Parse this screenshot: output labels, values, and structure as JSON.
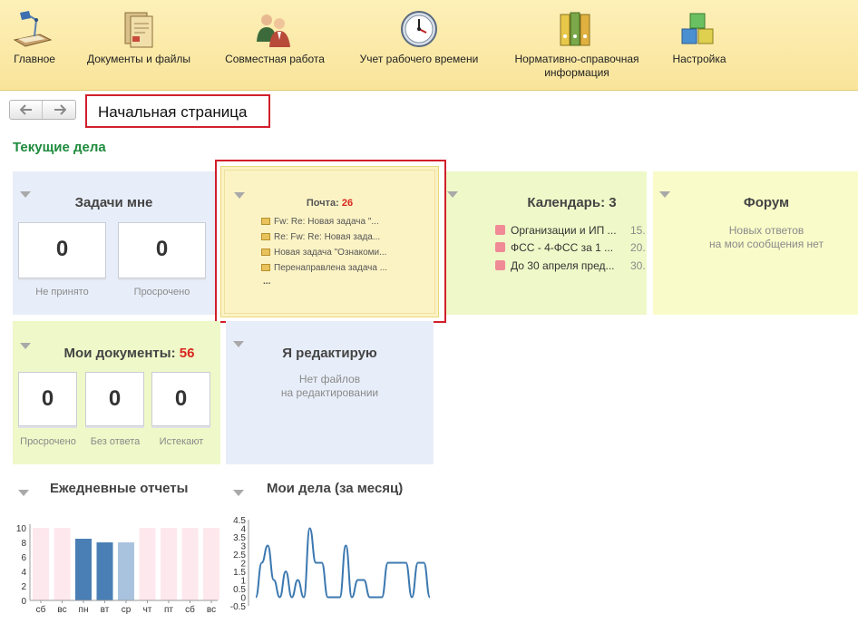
{
  "sections": [
    {
      "label": "Главное",
      "icon": "desk-lamp-icon"
    },
    {
      "label": "Документы и файлы",
      "icon": "documents-icon"
    },
    {
      "label": "Совместная работа",
      "icon": "people-icon"
    },
    {
      "label": "Учет рабочего времени",
      "icon": "clock-icon"
    },
    {
      "label": "Нормативно-справочная\nинформация",
      "icon": "binders-icon"
    },
    {
      "label": "Настройка",
      "icon": "cubes-icon"
    }
  ],
  "page": {
    "title": "Начальная страница",
    "section_heading": "Текущие дела"
  },
  "tasks": {
    "title": "Задачи мне",
    "not_accepted": "0",
    "overdue": "0",
    "not_accepted_label": "Не принято",
    "overdue_label": "Просрочено"
  },
  "mail": {
    "title": "Почта:",
    "count": "26",
    "items": [
      "Fw: Re: Новая задача \"...",
      "Re: Fw: Re: Новая зада...",
      "Новая задача \"Ознакоми...",
      "Перенаправлена задача ..."
    ],
    "more": "..."
  },
  "calendar": {
    "title": "Календарь: 3",
    "items": [
      {
        "text": "Организации и ИП ...",
        "date": "15."
      },
      {
        "text": "ФСС - 4-ФСС за 1 ...",
        "date": "20."
      },
      {
        "text": "До 30 апреля пред...",
        "date": "30."
      }
    ]
  },
  "forum": {
    "title": "Форум",
    "message": "Новых ответов\nна мои сообщения нет"
  },
  "my_documents": {
    "title": "Мои документы:",
    "count": "56",
    "overdue": "0",
    "no_answer": "0",
    "expiring": "0",
    "overdue_label": "Просрочено",
    "no_answer_label": "Без ответа",
    "expiring_label": "Истекают"
  },
  "editing": {
    "title": "Я редактирую",
    "message": "Нет файлов\nна редактировании"
  },
  "colors": {
    "topbar": "#f9e49a",
    "tile_blue": "#e8eef9",
    "tile_yellow": "#fbf3c4",
    "tile_green": "#eff8c8",
    "tile_lightyellow": "#f9fbc9",
    "accent_red": "#d11f2b",
    "heading_green": "#1e8b3c"
  },
  "chart_data": [
    {
      "type": "bar",
      "title": "Ежедневные отчеты",
      "categories": [
        "сб",
        "вс",
        "пн",
        "вт",
        "ср",
        "чт",
        "пт",
        "сб",
        "вс"
      ],
      "y_ticks": [
        "0",
        "2",
        "4",
        "6",
        "8",
        "10"
      ],
      "ylim": [
        0,
        10
      ],
      "series": [
        {
          "values": [
            0,
            0,
            8.5,
            8,
            8,
            0,
            0,
            0,
            0
          ],
          "colors": [
            "#fde8ee",
            "#fde8ee",
            "#4a7fb5",
            "#4a7fb5",
            "#a9c3df",
            "#fde8ee",
            "#fde8ee",
            "#fde8ee",
            "#fde8ee"
          ]
        }
      ],
      "background_values": [
        10,
        10,
        0,
        0,
        0,
        10,
        10,
        10,
        10
      ]
    },
    {
      "type": "line",
      "title": "Мои дела (за месяц)",
      "y_ticks": [
        "-0.5",
        "0",
        "0.5",
        "1",
        "1.5",
        "2",
        "2.5",
        "3",
        "3.5",
        "4",
        "4.5"
      ],
      "ylim": [
        -0.5,
        4.5
      ],
      "values": [
        0,
        2,
        3,
        1,
        0,
        1.5,
        0,
        1,
        0,
        4,
        2,
        2,
        0,
        0,
        0,
        3,
        0,
        1,
        1,
        0,
        0,
        0,
        2,
        2,
        2,
        2,
        0,
        2,
        2,
        0
      ]
    }
  ]
}
